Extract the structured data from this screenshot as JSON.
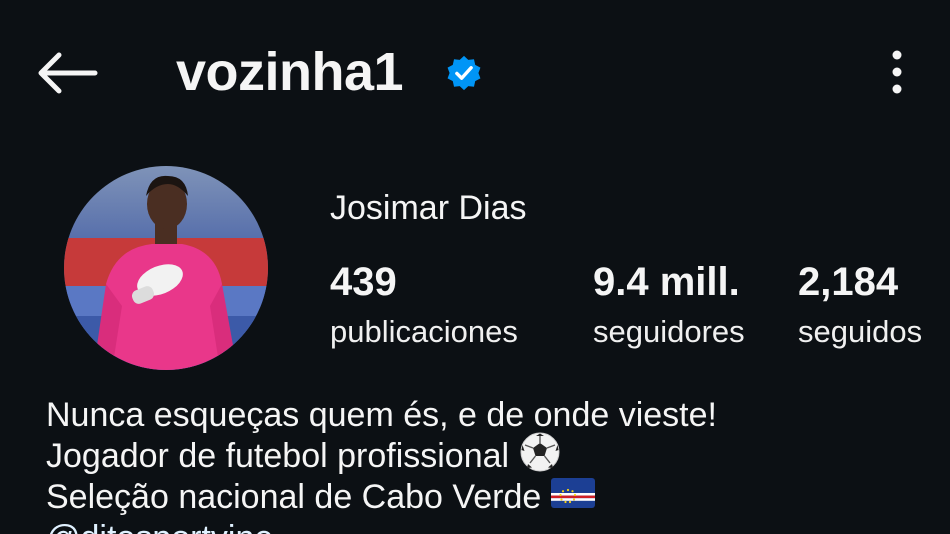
{
  "header": {
    "username": "vozinha1",
    "verified": true,
    "back_icon": "arrow-left-icon",
    "more_icon": "vertical-dots-icon",
    "verified_icon": "verified-badge-icon"
  },
  "profile": {
    "full_name": "Josimar Dias",
    "avatar": "profile-photo"
  },
  "stats": {
    "posts": {
      "value": "439",
      "label": "publicaciones"
    },
    "followers": {
      "value": "9.4 mill.",
      "label": "seguidores"
    },
    "following": {
      "value": "2,184",
      "label": "seguidos"
    }
  },
  "bio": {
    "line1": "Nunca esqueças quem és, e de onde vieste!",
    "line2": "Jogador de futebol profissional",
    "line2_icon": "soccer-ball-icon",
    "line3": "Seleção nacional de Cabo Verde",
    "line3_icon": "cape-verde-flag-icon",
    "link": "@ditosportvine"
  },
  "colors": {
    "background": "#0c1014",
    "text": "#f5f5f5",
    "verified_blue": "#0095f6",
    "link": "#e0f1ff"
  }
}
